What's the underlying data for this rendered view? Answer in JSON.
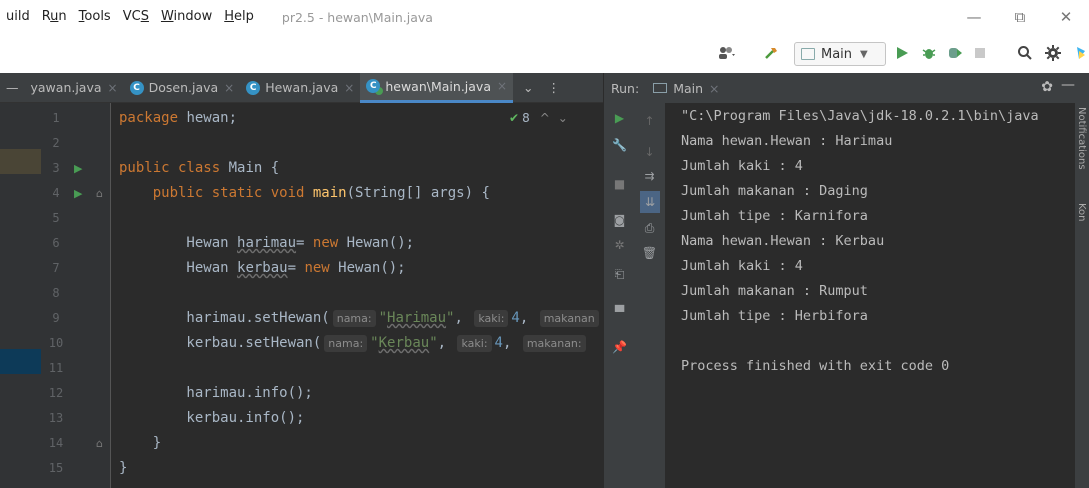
{
  "menubar": {
    "items": [
      "uild",
      "Run",
      "Tools",
      "VCS",
      "Window",
      "Help"
    ],
    "underline_letters": [
      "",
      "u",
      "T",
      "S",
      "W",
      "H"
    ],
    "window_title": "pr2.5 - hewan\\Main.java"
  },
  "window_controls": {
    "minimize": "—",
    "restore": "⧉",
    "close": "✕"
  },
  "toolbar": {
    "run_config_label": "Main",
    "run_config_arrow": "▼"
  },
  "editor_tabs": [
    {
      "label": "yawan.java",
      "close": "×",
      "has_icon": false,
      "active": false
    },
    {
      "label": "Dosen.java",
      "close": "×",
      "has_icon": true,
      "active": false
    },
    {
      "label": "Hewan.java",
      "close": "×",
      "has_icon": true,
      "active": false
    },
    {
      "label": "hewan\\Main.java",
      "close": "×",
      "has_icon": true,
      "active": true
    }
  ],
  "editor": {
    "warning_count": "8",
    "line_numbers": [
      "1",
      "2",
      "3",
      "4",
      "5",
      "6",
      "7",
      "8",
      "9",
      "10",
      "11",
      "12",
      "13",
      "14",
      "15"
    ]
  },
  "run_panel": {
    "label": "Run:",
    "tab_label": "Main",
    "console_lines": [
      "\"C:\\Program Files\\Java\\jdk-18.0.2.1\\bin\\java",
      "Nama hewan.Hewan : Harimau",
      "Jumlah kaki : 4",
      "Jumlah makanan : Daging",
      "Jumlah tipe : Karnifora",
      "Nama hewan.Hewan : Kerbau",
      "Jumlah kaki : 4",
      "Jumlah makanan : Rumput",
      "Jumlah tipe : Herbifora",
      "",
      "Process finished with exit code 0"
    ]
  },
  "side_strip": {
    "notifications": "Notifications",
    "extra": "Kon"
  },
  "colors": {
    "run_green": "#499c54",
    "active_tab_underline": "#4a88c7",
    "editor_bg": "#2b2b2b"
  }
}
